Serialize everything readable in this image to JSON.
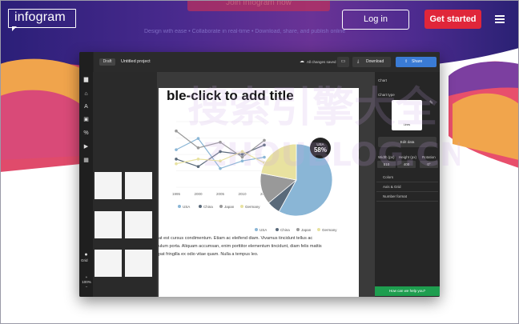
{
  "brand": {
    "name": "infogram"
  },
  "nav": {
    "ghost_cta": "Join Infogram now",
    "login": "Log in",
    "get_started": "Get started"
  },
  "tagline": "Design with ease  •  Collaborate in real-time  •  Download, share, and publish online",
  "editor": {
    "status": "Draft",
    "project_name": "Untitled project",
    "save_status": "All changes saved",
    "download": "Download",
    "share": "Share",
    "grid_label": "Grid",
    "zoom": "100%",
    "canvas_title": "ble-click to add title",
    "body_text": [
      "at est cursus condimentum. Etiam ac eleifend diam. Vivamus tincidunt tellus ac",
      "ulum porta. Aliquam accumsan, enim porttitor elementum tincidunt, diam felis mattis",
      "pat fringilla ex odio vitae quam. Nulla a tempus leo."
    ],
    "right_panel": {
      "header": "Chart",
      "chart_type_label": "Chart type",
      "thumb_label": "Lines",
      "edit_data": "Edit data",
      "width_label": "Width (px)",
      "width_value": "510",
      "height_label": "Height (px)",
      "height_value": "400",
      "rotation_label": "Rotation",
      "rotation_value": "0°",
      "sections": [
        "Colors",
        "Axis & Grid",
        "Number format"
      ],
      "help": "How can we help you?"
    }
  },
  "chart_data": [
    {
      "type": "line",
      "x": [
        "1995",
        "2000",
        "2005",
        "2010",
        "2015"
      ],
      "series": [
        {
          "name": "USA",
          "color": "#8ab6d6",
          "values": [
            40,
            52,
            20,
            28,
            32
          ]
        },
        {
          "name": "China",
          "color": "#5a6a7a",
          "values": [
            30,
            22,
            38,
            35,
            45
          ]
        },
        {
          "name": "Japan",
          "color": "#999999",
          "values": [
            60,
            42,
            48,
            32,
            50
          ]
        },
        {
          "name": "Germany",
          "color": "#e8e2a0",
          "values": [
            25,
            30,
            28,
            38,
            26
          ]
        }
      ]
    },
    {
      "type": "pie",
      "categories": [
        "USA",
        "China",
        "Japan",
        "Germany"
      ],
      "values": [
        58,
        6,
        14,
        22
      ],
      "colors": [
        "#8ab6d6",
        "#5a6a7a",
        "#999999",
        "#e8e2a0"
      ],
      "highlight": {
        "label": "USA",
        "value": "58%"
      }
    }
  ],
  "watermark": {
    "line1": "搜索引擎大全",
    "line2": "ZHOUBLOG.CN"
  }
}
